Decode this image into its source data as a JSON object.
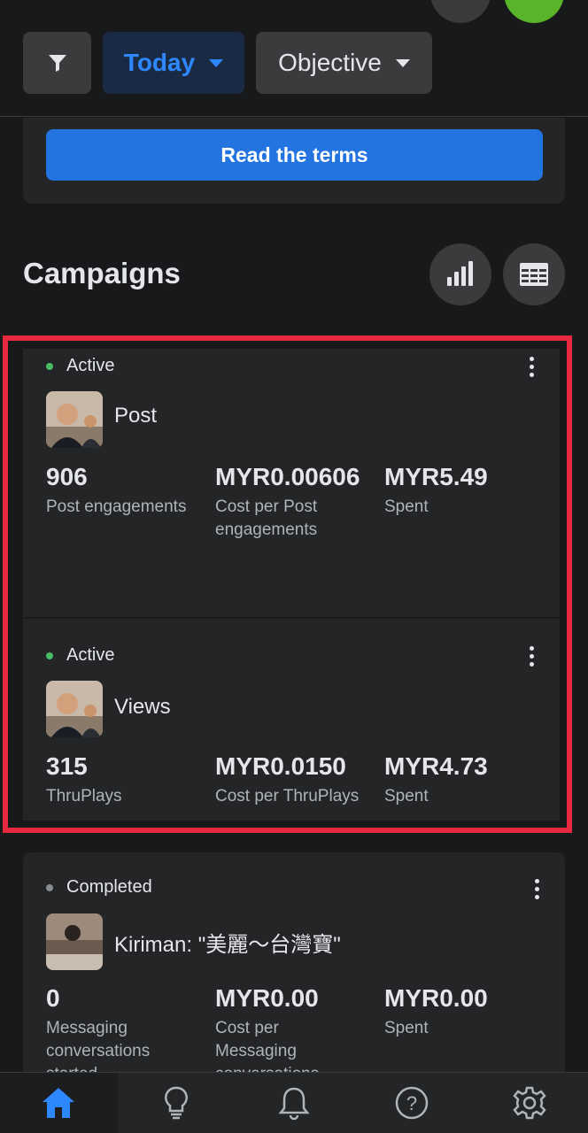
{
  "filters": {
    "date_label": "Today",
    "objective_label": "Objective"
  },
  "terms": {
    "button_label": "Read the terms"
  },
  "campaigns": {
    "title": "Campaigns",
    "items": [
      {
        "status": "Active",
        "name": "Post",
        "metrics": [
          {
            "value": "906",
            "label": "Post engagements"
          },
          {
            "value": "MYR0.00606",
            "label": "Cost per Post engagements"
          },
          {
            "value": "MYR5.49",
            "label": "Spent"
          }
        ]
      },
      {
        "status": "Active",
        "name": "Views",
        "metrics": [
          {
            "value": "315",
            "label": "ThruPlays"
          },
          {
            "value": "MYR0.0150",
            "label": "Cost per ThruPlays"
          },
          {
            "value": "MYR4.73",
            "label": "Spent"
          }
        ]
      },
      {
        "status": "Completed",
        "name": "Kiriman: \"美麗～台灣寶\"",
        "metrics": [
          {
            "value": "0",
            "label": "Messaging conversations started"
          },
          {
            "value": "MYR0.00",
            "label": "Cost per Messaging conversations started"
          },
          {
            "value": "MYR0.00",
            "label": "Spent"
          }
        ]
      }
    ]
  },
  "colors": {
    "accent": "#2d88ff",
    "active_dot": "#45bd62",
    "completed_dot": "#8a8d91",
    "highlight": "#e8283f"
  },
  "nav": [
    "home-icon",
    "lightbulb-icon",
    "bell-icon",
    "help-icon",
    "gear-icon"
  ]
}
